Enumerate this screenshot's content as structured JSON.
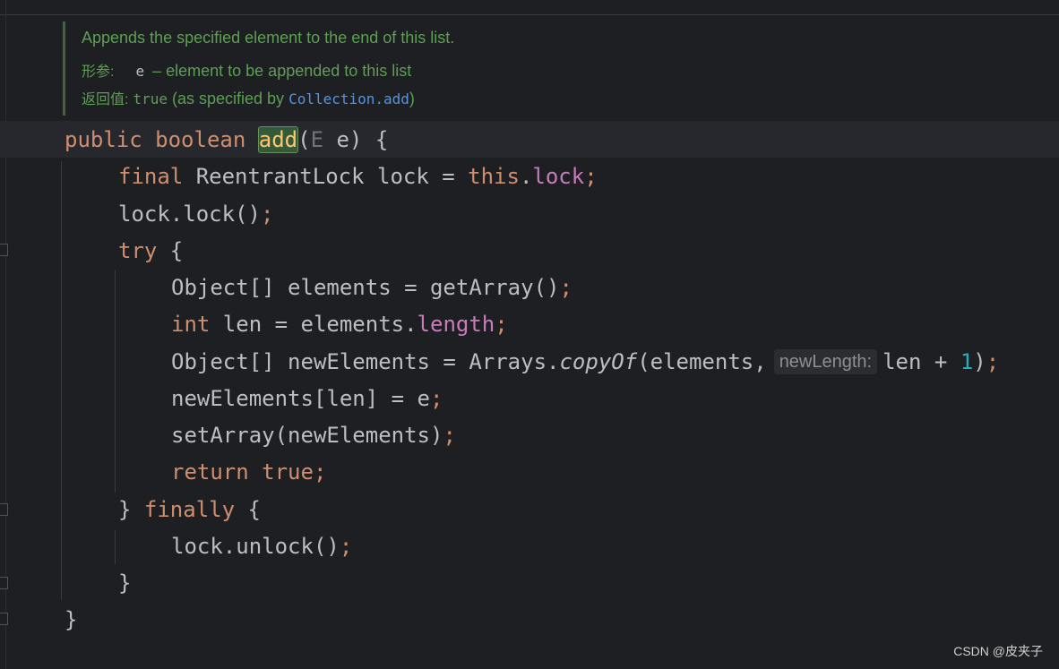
{
  "doc": {
    "summary": "Appends the specified element to the end of this list.",
    "param_tag": "形参:",
    "param_name": "e",
    "param_desc": " – element to be appended to this list",
    "return_tag": "返回值:",
    "return_value": "true",
    "return_desc": " (as specified by ",
    "return_link": "Collection.add",
    "return_close": ")"
  },
  "code": {
    "l1_public": "public",
    "l1_boolean": "boolean",
    "l1_method": "add",
    "l1_paren_open": "(",
    "l1_type": "E",
    "l1_rest": " e) {",
    "l2_final": "final",
    "l2_rest": " ReentrantLock lock = ",
    "l2_this": "this",
    "l2_dot": ".",
    "l2_field": "lock",
    "l2_semi": ";",
    "l3_text": "lock.lock()",
    "l3_semi": ";",
    "l4_try": "try",
    "l4_brace": " {",
    "l5_text": "Object[] elements = getArray()",
    "l5_semi": ";",
    "l6_int": "int",
    "l6_rest": " len = elements.",
    "l6_field": "length",
    "l6_semi": ";",
    "l7_text": "Object[] newElements = Arrays.",
    "l7_method": "copyOf",
    "l7_args": "(elements,",
    "l7_hint": "newLength:",
    "l7_len": "len + ",
    "l7_num": "1",
    "l7_close": ")",
    "l7_semi": ";",
    "l8_text": "newElements[len] = e",
    "l8_semi": ";",
    "l9_text": "setArray(newElements)",
    "l9_semi": ";",
    "l10_return": "return",
    "l10_true": "true",
    "l10_semi": ";",
    "l11_close": "} ",
    "l11_finally": "finally",
    "l11_brace": " {",
    "l12_text": "lock.unlock()",
    "l12_semi": ";",
    "l13_text": "}",
    "l14_text": "}"
  },
  "watermark": "CSDN @皮夹子",
  "colors": {
    "background": "#1e1f22",
    "keyword": "#cf8e6d",
    "identifier": "#bcbec4",
    "field": "#c77dbb",
    "number": "#2aacb8",
    "doc_comment": "#5f9e55",
    "doc_link": "#5693e2",
    "highlight": "#ffc66d"
  }
}
